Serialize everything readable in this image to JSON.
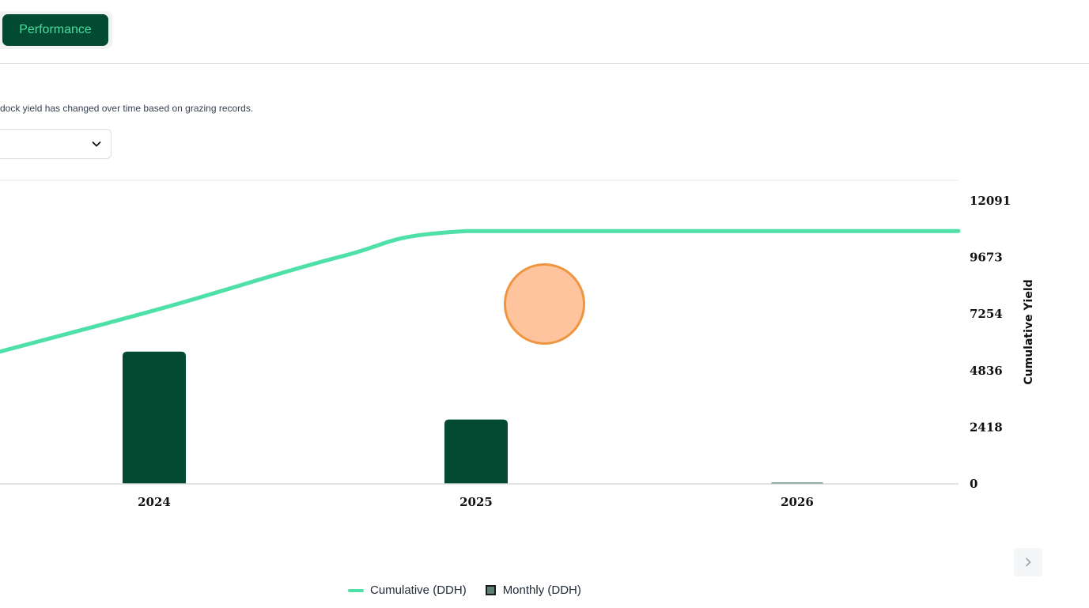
{
  "tabs": {
    "active_label": "Performance"
  },
  "description": "dock yield has changed over time based on grazing records.",
  "select": {
    "value": ""
  },
  "colors": {
    "cumulative": "#4ee0a6",
    "monthly": "#034a33",
    "tab_bg": "#034a33",
    "tab_text": "#4ade9e",
    "cursor_fill": "#fdba8c",
    "cursor_stroke": "#f0953f"
  },
  "chart_data": {
    "type": "bar",
    "categories": [
      "2024",
      "2025",
      "2026"
    ],
    "series": [
      {
        "name": "Monthly (DDH)",
        "kind": "bar",
        "values": [
          5650,
          2750,
          50
        ]
      },
      {
        "name": "Cumulative (DDH)",
        "kind": "line",
        "x": [
          "",
          "2024",
          "",
          "2025",
          "2026",
          ""
        ],
        "values": [
          5650,
          7550,
          9700,
          10800,
          10800,
          10800
        ]
      }
    ],
    "ylabel_right": "Cumulative Yield",
    "y_ticks": [
      "0",
      "2418",
      "4836",
      "7254",
      "9673",
      "12091"
    ],
    "ylim": [
      0,
      12091
    ],
    "grid": false,
    "legend": "bottom-center"
  },
  "legend": {
    "cumulative": "Cumulative (DDH)",
    "monthly": "Monthly (DDH)"
  },
  "icons": {
    "select_chevron": "chevron-down-icon",
    "next": "chevron-right-icon"
  }
}
